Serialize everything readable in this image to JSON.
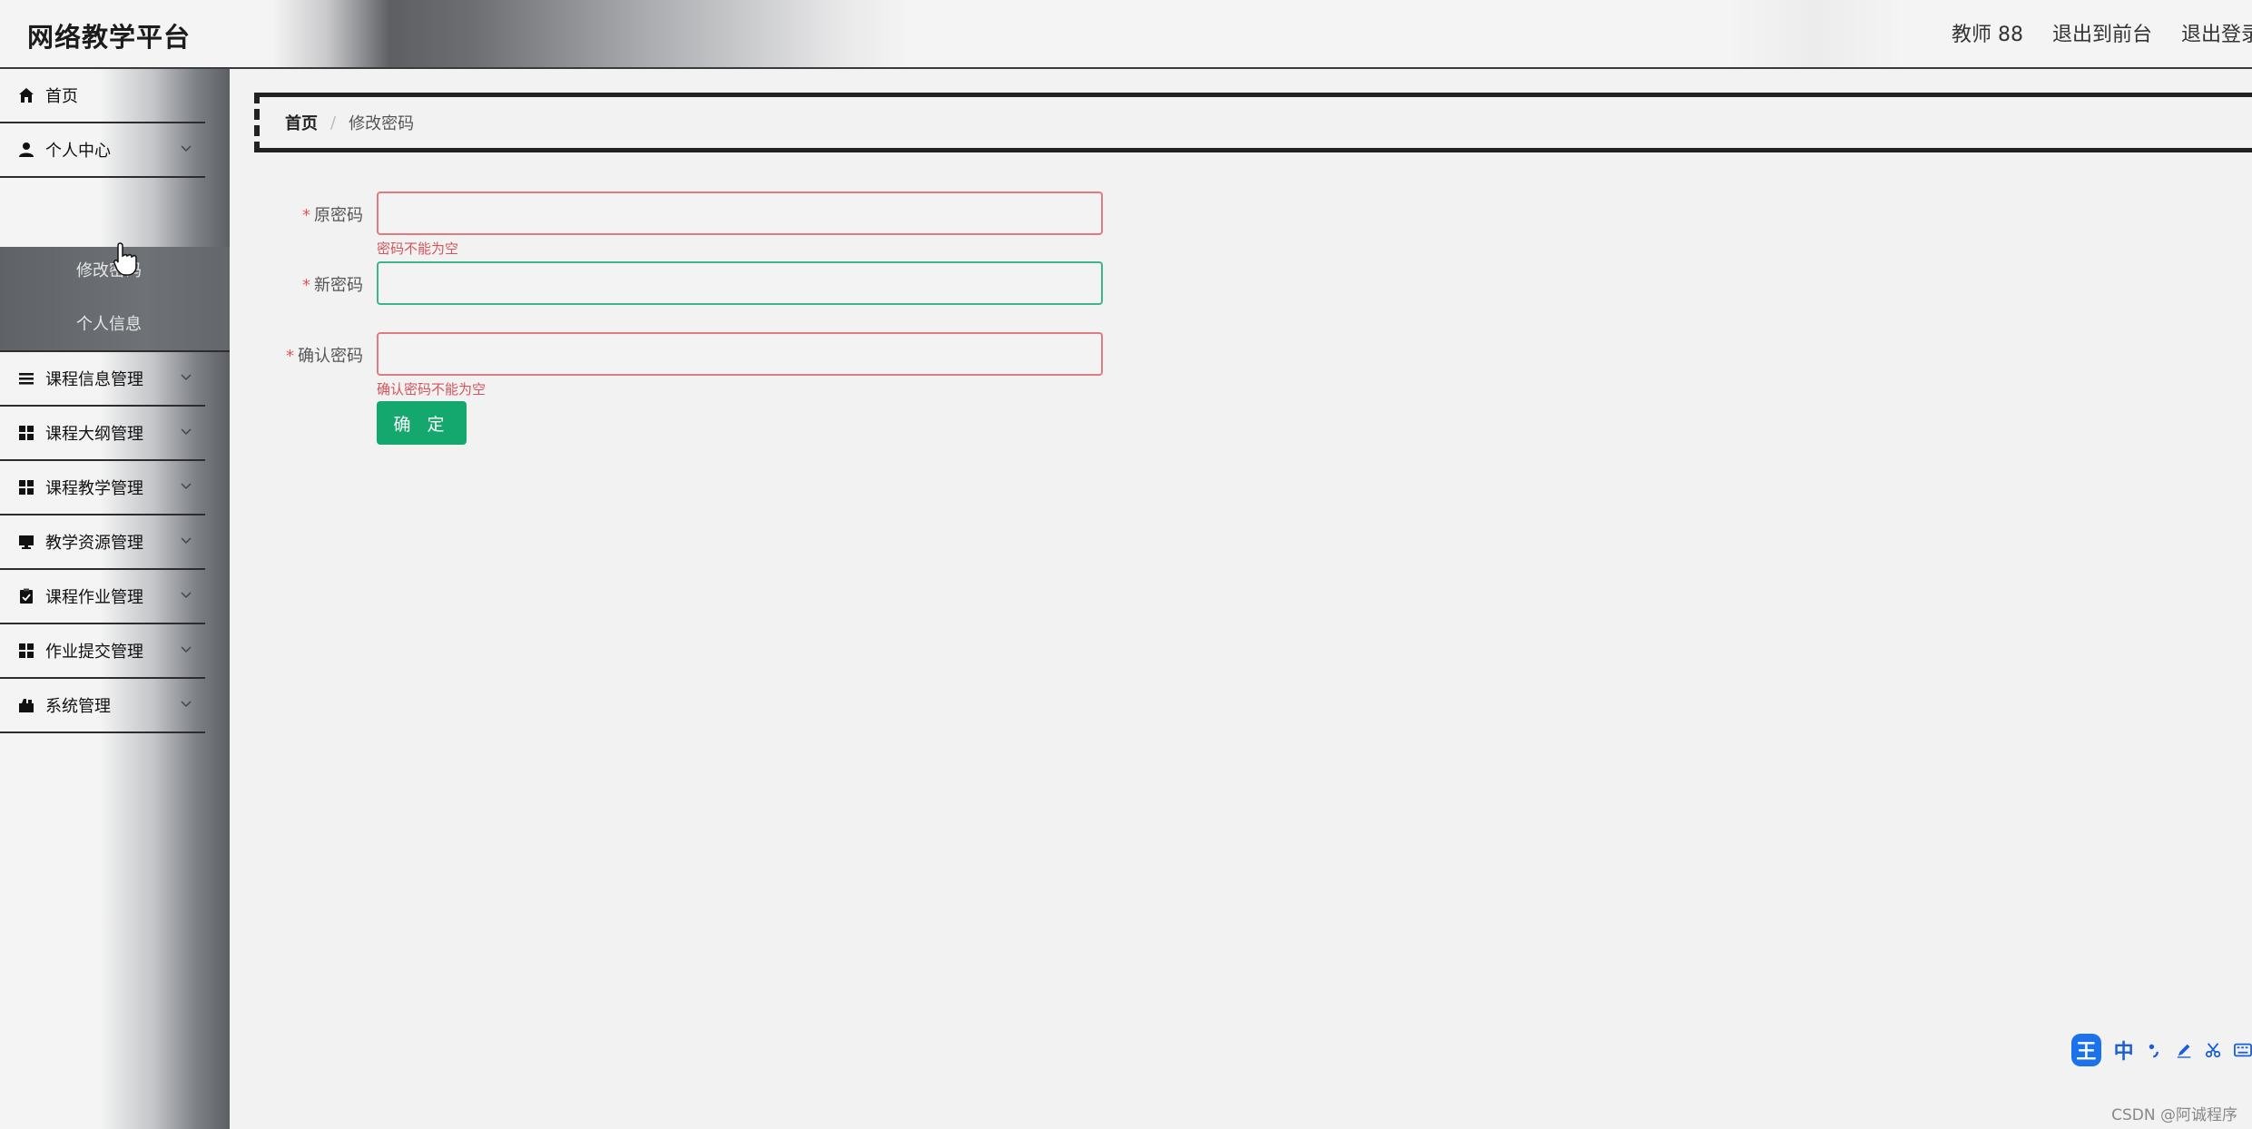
{
  "header": {
    "brand": "网络教学平台",
    "user": "教师 88",
    "to_front": "退出到前台",
    "logout": "退出登录"
  },
  "sidebar": {
    "items": [
      {
        "label": "首页",
        "icon": "home-icon"
      },
      {
        "label": "个人中心",
        "icon": "user-icon"
      },
      {
        "label": "课程信息管理",
        "icon": "list-icon"
      },
      {
        "label": "课程大纲管理",
        "icon": "grid-icon"
      },
      {
        "label": "课程教学管理",
        "icon": "grid-icon"
      },
      {
        "label": "教学资源管理",
        "icon": "monitor-icon"
      },
      {
        "label": "课程作业管理",
        "icon": "clipboard-icon"
      },
      {
        "label": "作业提交管理",
        "icon": "grid-icon"
      },
      {
        "label": "系统管理",
        "icon": "briefcase-icon"
      }
    ],
    "submenu": [
      {
        "label": "修改密码"
      },
      {
        "label": "个人信息"
      }
    ]
  },
  "breadcrumb": {
    "home": "首页",
    "separator": "/",
    "current": "修改密码"
  },
  "form": {
    "old_password": {
      "label": "原密码",
      "value": "",
      "error": "密码不能为空"
    },
    "new_password": {
      "label": "新密码",
      "value": ""
    },
    "confirm_password": {
      "label": "确认密码",
      "value": "",
      "error": "确认密码不能为空"
    },
    "submit_label": "确 定",
    "required_mark": "*"
  },
  "ime_toolbar": {
    "logo": "王",
    "mode": "中"
  },
  "watermark": "CSDN @阿诚程序",
  "colors": {
    "accent": "#14a86e",
    "error": "#d4545b",
    "valid": "#3fb28e"
  }
}
